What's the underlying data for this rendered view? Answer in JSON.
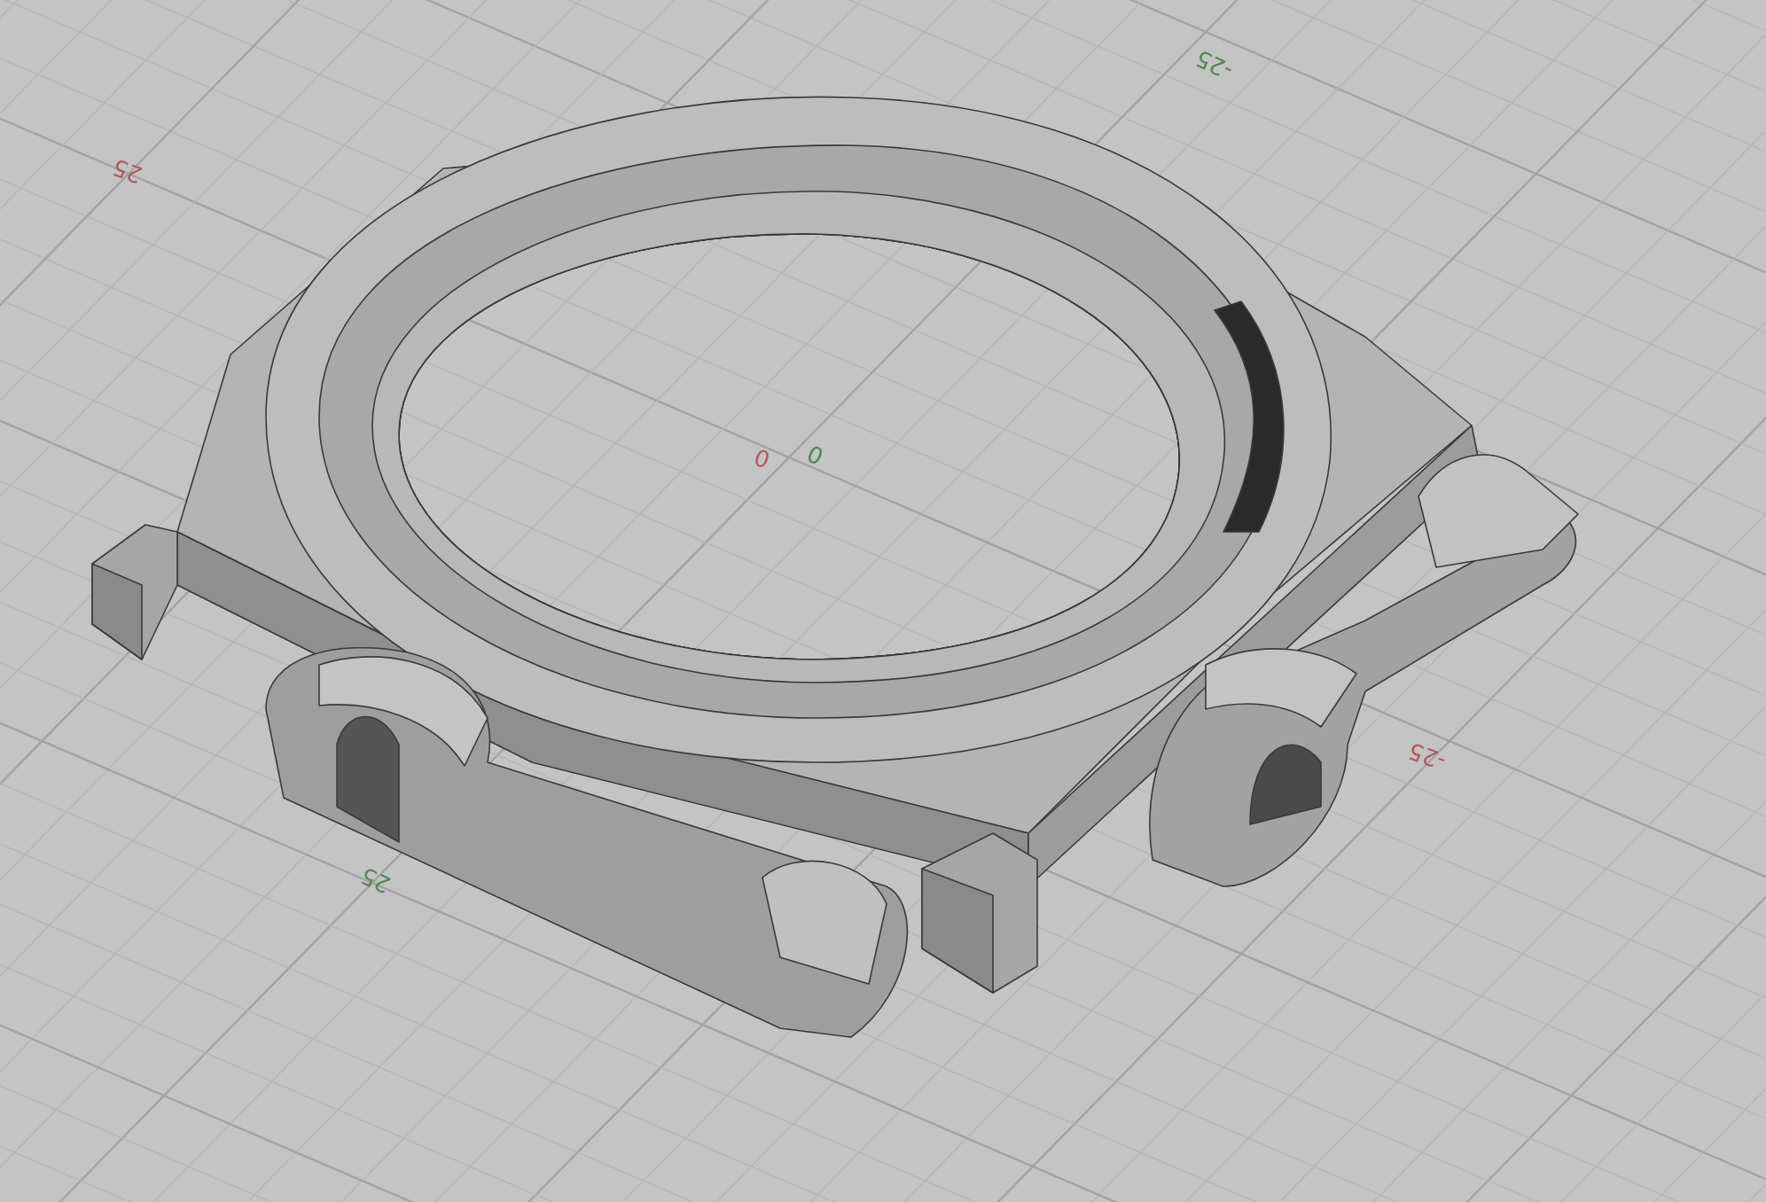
{
  "viewport": {
    "axis_labels": [
      {
        "text": "25",
        "color": "#b05c5c"
      },
      {
        "text": "-25",
        "color": "#4f8a4f"
      },
      {
        "text": "0",
        "color": "#b05c5c"
      },
      {
        "text": "0",
        "color": "#4f8a4f"
      },
      {
        "text": "-25",
        "color": "#b05c5c"
      },
      {
        "text": "25",
        "color": "#4f8a4f"
      }
    ]
  }
}
